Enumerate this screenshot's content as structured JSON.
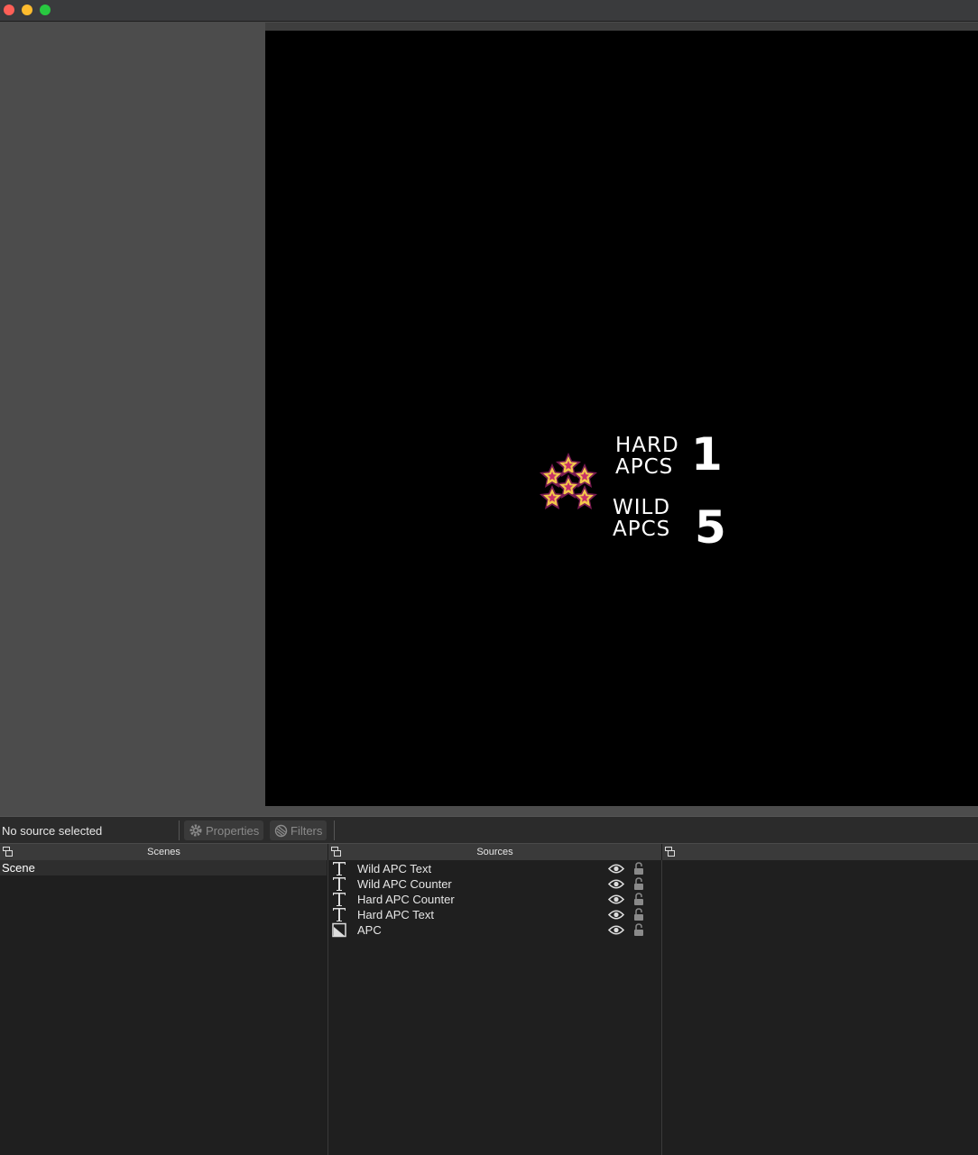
{
  "window": {
    "controls": [
      "close",
      "minimize",
      "maximize"
    ]
  },
  "canvas": {
    "overlay": {
      "hard_text_line1": "HARD",
      "hard_text_line2": "APCS",
      "hard_counter": "1",
      "wild_text_line1": "WILD",
      "wild_text_line2": "APCS",
      "wild_counter": "5",
      "badge_icon": "stars-badge-icon"
    }
  },
  "toolbar": {
    "status": "No source selected",
    "properties_label": "Properties",
    "filters_label": "Filters"
  },
  "scenes": {
    "title": "Scenes",
    "items": [
      "Scene"
    ]
  },
  "sources": {
    "title": "Sources",
    "items": [
      {
        "name": "Wild APC Text",
        "type": "text"
      },
      {
        "name": "Wild APC Counter",
        "type": "text"
      },
      {
        "name": "Hard APC Counter",
        "type": "text"
      },
      {
        "name": "Hard APC Text",
        "type": "text"
      },
      {
        "name": "APC",
        "type": "image"
      }
    ]
  },
  "colors": {
    "accent_close": "#fe5f57",
    "accent_min": "#febc2e",
    "accent_max": "#28c840",
    "star_gold": "#f2c84b",
    "star_border": "#8a1f5a"
  }
}
